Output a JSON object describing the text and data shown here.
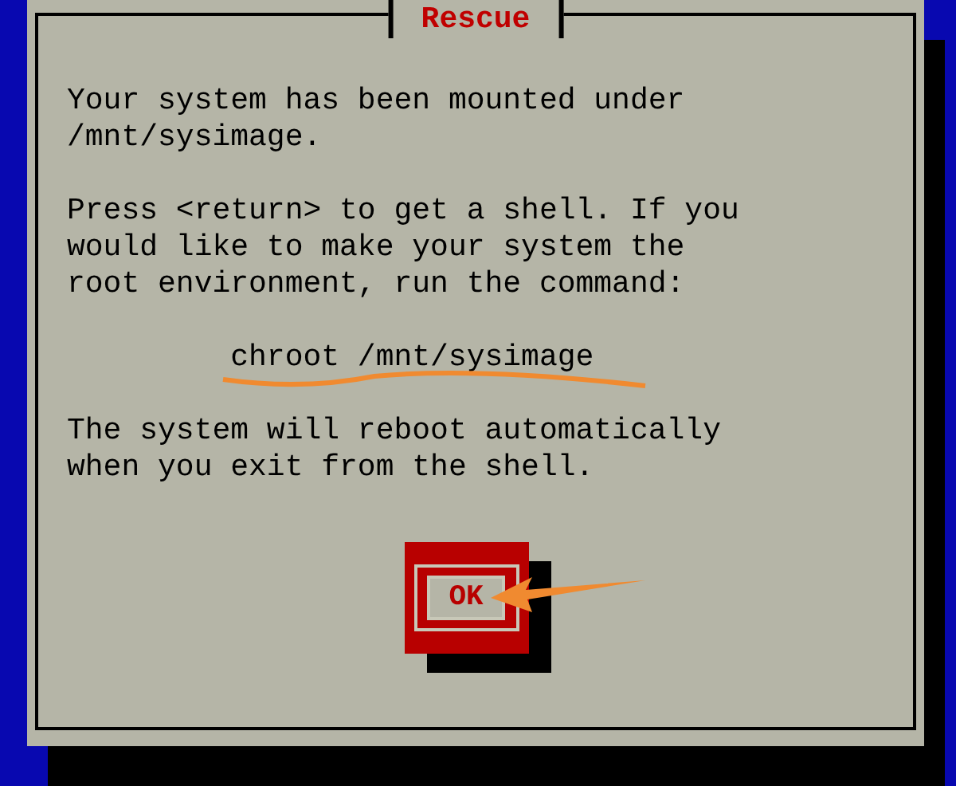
{
  "dialog": {
    "title": "Rescue",
    "paragraphs": [
      [
        "Your system has been mounted under",
        "/mnt/sysimage."
      ],
      [
        "Press <return> to get a shell. If you",
        "would like to make your system the",
        "root environment, run the command:"
      ]
    ],
    "command": "chroot /mnt/sysimage",
    "closing": [
      "The system will reboot automatically",
      "when you exit from the shell."
    ],
    "button": {
      "label": "OK",
      "focused": true
    }
  }
}
